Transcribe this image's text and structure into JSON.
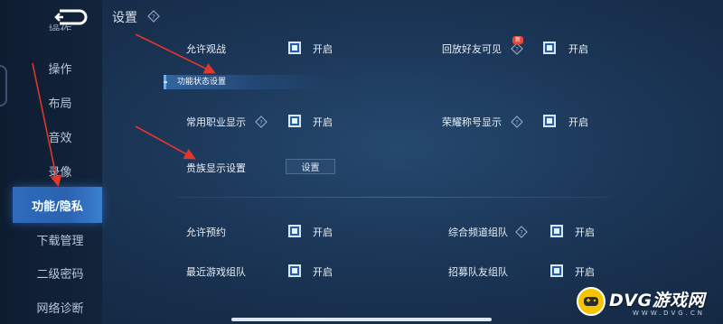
{
  "page_title": "设置",
  "sidebar": {
    "partial_label": "操作",
    "items": [
      {
        "label": "操作"
      },
      {
        "label": "布局"
      },
      {
        "label": "音效"
      },
      {
        "label": "录像"
      },
      {
        "label": "功能/隐私"
      },
      {
        "label": "下载管理"
      },
      {
        "label": "二级密码"
      },
      {
        "label": "网络诊断"
      }
    ],
    "active_item": "功能/隐私"
  },
  "section_banner": "功能状态设置",
  "settings": {
    "allow_spectate": {
      "label": "允许观战",
      "state": "开启",
      "checked": true
    },
    "replay_visible": {
      "label": "回放好友可见",
      "state": "开启",
      "checked": true,
      "badge": "新"
    },
    "common_job_display": {
      "label": "常用职业显示",
      "state": "开启",
      "checked": true
    },
    "honor_title_display": {
      "label": "荣耀称号显示",
      "state": "开启",
      "checked": true
    },
    "noble_display": {
      "label": "贵族显示设置",
      "button": "设置"
    },
    "allow_booking": {
      "label": "允许预约",
      "state": "开启",
      "checked": true
    },
    "channel_team": {
      "label": "综合频道组队",
      "state": "开启",
      "checked": true
    },
    "recent_game_team": {
      "label": "最近游戏组队",
      "state": "开启",
      "checked": true
    },
    "recruit_team": {
      "label": "招募队友组队",
      "state": "开启",
      "checked": true
    }
  },
  "watermark": {
    "title": "DVG游戏网",
    "subtitle": "WWW.DVG.CN"
  },
  "colors": {
    "accent": "#2e6bbb",
    "checkbox": "#1f5fb3",
    "arrow": "#e0362c",
    "badge": "#e0463a"
  }
}
